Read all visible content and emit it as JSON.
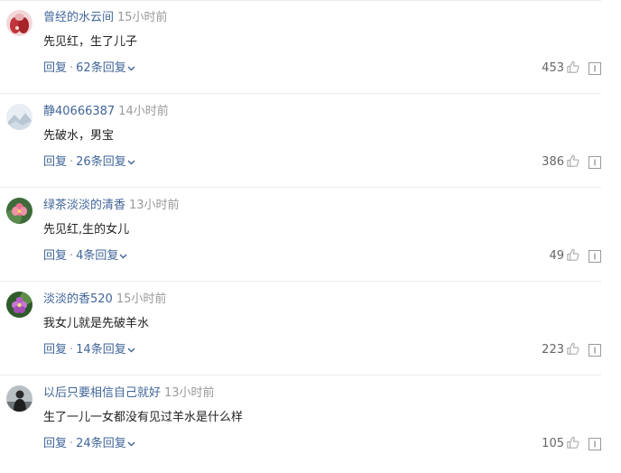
{
  "comments": [
    {
      "user": "曾经的水云间",
      "time": "15小时前",
      "text": "先见红，生了儿子",
      "reply_label": "回复",
      "dot": "·",
      "replies": "62条回复",
      "likes": "453",
      "avatar_icon": "red-face-avatar"
    },
    {
      "user": "静40666387",
      "time": "14小时前",
      "text": "先破水，男宝",
      "reply_label": "回复",
      "dot": "·",
      "replies": "26条回复",
      "likes": "386",
      "avatar_icon": "mountain-avatar"
    },
    {
      "user": "绿茶淡淡的清香",
      "time": "13小时前",
      "text": "先见红,生的女儿",
      "reply_label": "回复",
      "dot": "·",
      "replies": "4条回复",
      "likes": "49",
      "avatar_icon": "pink-lotus-avatar"
    },
    {
      "user": "淡淡的香520",
      "time": "15小时前",
      "text": "我女儿就是先破羊水",
      "reply_label": "回复",
      "dot": "·",
      "replies": "14条回复",
      "likes": "223",
      "avatar_icon": "purple-flower-avatar"
    },
    {
      "user": "以后只要相信自己就好",
      "time": "13小时前",
      "text": "生了一儿一女都没有见过羊水是什么样",
      "reply_label": "回复",
      "dot": "·",
      "replies": "24条回复",
      "likes": "105",
      "avatar_icon": "silhouette-avatar"
    }
  ],
  "colors": {
    "link": "#406599",
    "muted": "#999999",
    "text": "#222222",
    "divider": "#ececec"
  }
}
